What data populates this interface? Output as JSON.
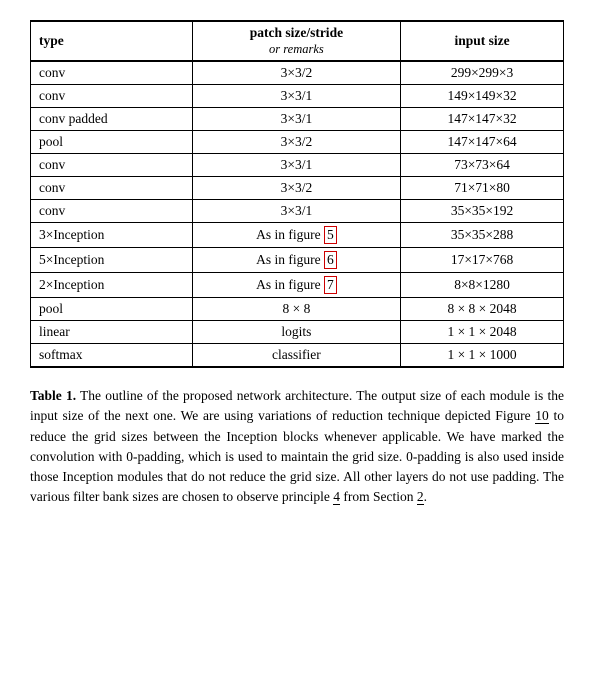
{
  "table": {
    "headers": {
      "type": "type",
      "patch": "patch size/stride",
      "patch_sub": "or remarks",
      "input": "input size"
    },
    "rows": [
      {
        "type": "conv",
        "patch": "3×3/2",
        "input": "299×299×3"
      },
      {
        "type": "conv",
        "patch": "3×3/1",
        "input": "149×149×32"
      },
      {
        "type": "conv padded",
        "patch": "3×3/1",
        "input": "147×147×32"
      },
      {
        "type": "pool",
        "patch": "3×3/2",
        "input": "147×147×64"
      },
      {
        "type": "conv",
        "patch": "3×3/1",
        "input": "73×73×64"
      },
      {
        "type": "conv",
        "patch": "3×3/2",
        "input": "71×71×80"
      },
      {
        "type": "conv",
        "patch": "3×3/1",
        "input": "35×35×192"
      },
      {
        "type": "3×Inception",
        "patch": "As in figure 5",
        "patch_highlight": "5",
        "input": "35×35×288"
      },
      {
        "type": "5×Inception",
        "patch": "As in figure 6",
        "patch_highlight": "6",
        "input": "17×17×768"
      },
      {
        "type": "2×Inception",
        "patch": "As in figure 7",
        "patch_highlight": "7",
        "input": "8×8×1280"
      },
      {
        "type": "pool",
        "patch": "8 × 8",
        "input": "8 × 8 × 2048"
      },
      {
        "type": "linear",
        "patch": "logits",
        "input": "1 × 1 × 2048"
      },
      {
        "type": "softmax",
        "patch": "classifier",
        "input": "1 × 1 × 1000"
      }
    ]
  },
  "caption": {
    "label": "Table 1.",
    "text": " The outline of the proposed network architecture.  The output size of each module is the input size of the next one.  We are using variations of reduction technique depicted Figure ",
    "link1": "10",
    "text2": " to reduce the grid sizes between the Inception blocks whenever applicable.  We have marked the convolution with 0-padding, which is used to maintain the grid size.  0-padding is also used inside those Inception modules that do not reduce the grid size.  All other layers do not use padding.  The various filter bank sizes are chosen to observe principle ",
    "link2": "4",
    "text3": " from Section ",
    "link3": "2",
    "text4": "."
  }
}
